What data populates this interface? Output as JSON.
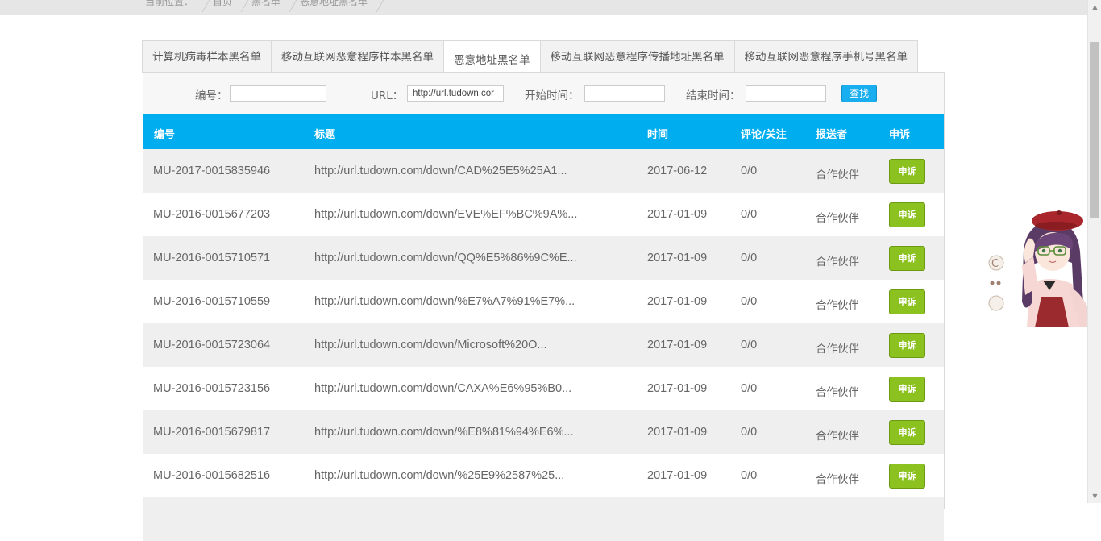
{
  "breadcrumb": [
    "当前位置：",
    "首页",
    "黑名单",
    "恶意地址黑名单"
  ],
  "tabs": [
    {
      "label": "计算机病毒样本黑名单",
      "active": false
    },
    {
      "label": "移动互联网恶意程序样本黑名单",
      "active": false
    },
    {
      "label": "恶意地址黑名单",
      "active": true
    },
    {
      "label": "移动互联网恶意程序传播地址黑名单",
      "active": false
    },
    {
      "label": "移动互联网恶意程序手机号黑名单",
      "active": false
    }
  ],
  "filter": {
    "id_label": "编号：",
    "id_value": "",
    "url_label": "URL：",
    "url_value": "http://url.tudown.cor",
    "start_label": "开始时间：",
    "start_value": "",
    "end_label": "结束时间：",
    "end_value": "",
    "search_label": "查找"
  },
  "table": {
    "headers": [
      "编号",
      "标题",
      "时间",
      "评论/关注",
      "报送者",
      "申诉"
    ],
    "rows": [
      {
        "id": "MU-2017-0015835946",
        "title": "http://url.tudown.com/down/CAD%25E5%25A1...",
        "date": "2017-06-12",
        "comments": "0/0",
        "reporter": "合作伙伴",
        "action": "申诉"
      },
      {
        "id": "MU-2016-0015677203",
        "title": "http://url.tudown.com/down/EVE%EF%BC%9A%...",
        "date": "2017-01-09",
        "comments": "0/0",
        "reporter": "合作伙伴",
        "action": "申诉"
      },
      {
        "id": "MU-2016-0015710571",
        "title": "http://url.tudown.com/down/QQ%E5%86%9C%E...",
        "date": "2017-01-09",
        "comments": "0/0",
        "reporter": "合作伙伴",
        "action": "申诉"
      },
      {
        "id": "MU-2016-0015710559",
        "title": "http://url.tudown.com/down/%E7%A7%91%E7%...",
        "date": "2017-01-09",
        "comments": "0/0",
        "reporter": "合作伙伴",
        "action": "申诉"
      },
      {
        "id": "MU-2016-0015723064",
        "title": "http://url.tudown.com/down/Microsoft%20O...",
        "date": "2017-01-09",
        "comments": "0/0",
        "reporter": "合作伙伴",
        "action": "申诉"
      },
      {
        "id": "MU-2016-0015723156",
        "title": "http://url.tudown.com/down/CAXA%E6%95%B0...",
        "date": "2017-01-09",
        "comments": "0/0",
        "reporter": "合作伙伴",
        "action": "申诉"
      },
      {
        "id": "MU-2016-0015679817",
        "title": "http://url.tudown.com/down/%E8%81%94%E6%...",
        "date": "2017-01-09",
        "comments": "0/0",
        "reporter": "合作伙伴",
        "action": "申诉"
      },
      {
        "id": "MU-2016-0015682516",
        "title": "http://url.tudown.com/down/%25E9%2587%25...",
        "date": "2017-01-09",
        "comments": "0/0",
        "reporter": "合作伙伴",
        "action": "申诉"
      }
    ]
  },
  "colors": {
    "header_blue": "#00adef",
    "appeal_green": "#8cc220",
    "search_blue": "#19aef0"
  },
  "icons": {
    "scroll_up": "scroll-up-arrow-icon",
    "scroll_down": "scroll-down-arrow-icon",
    "mascot": "anime-mascot-widget"
  }
}
